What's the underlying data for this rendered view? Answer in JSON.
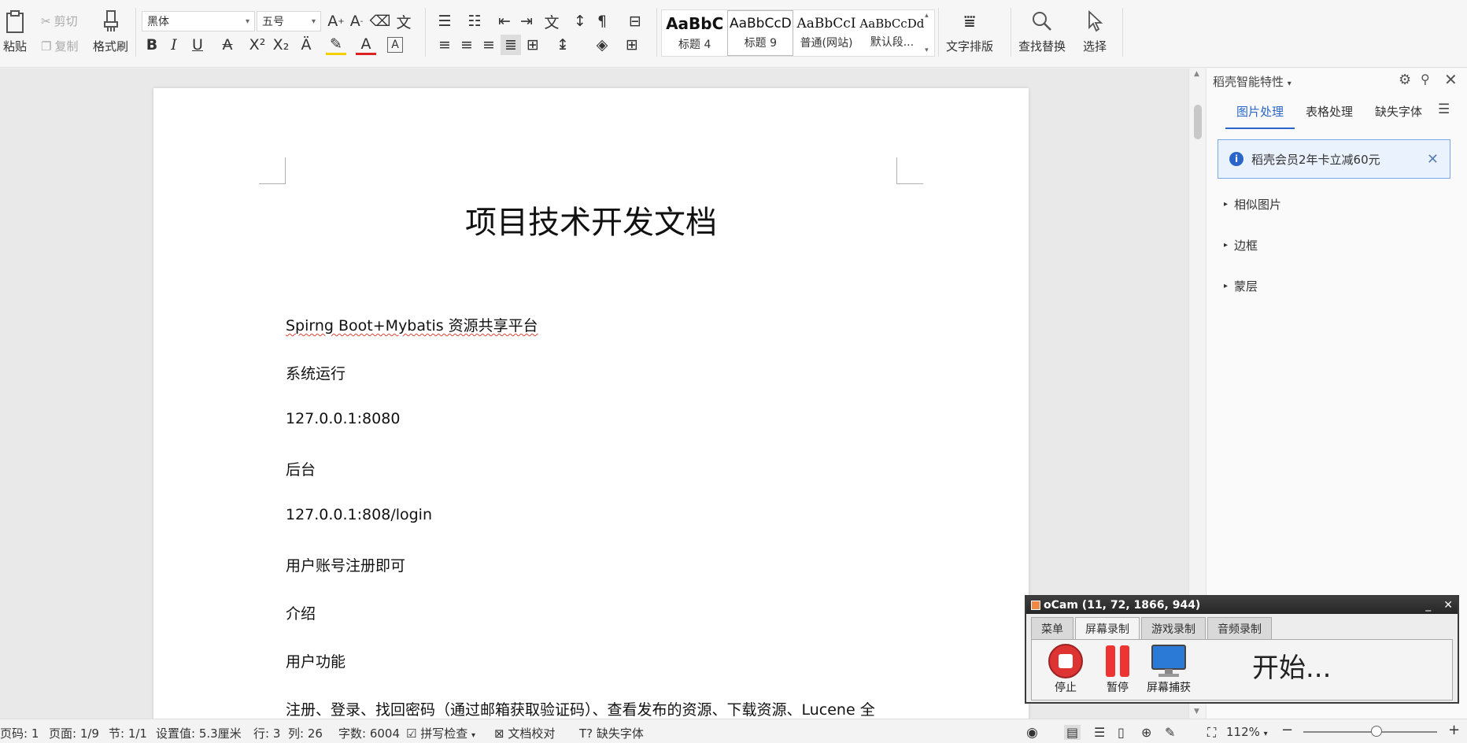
{
  "ribbon": {
    "paste": "粘贴",
    "cut": "剪切",
    "copy": "复制",
    "format_painter": "格式刷",
    "font_name": "黑体",
    "font_size": "五号",
    "styles": [
      {
        "preview": "AaBbC",
        "name": "标题 4"
      },
      {
        "preview": "AaBbCcD",
        "name": "标题 9"
      },
      {
        "preview": "AaBbCcI",
        "name": "普通(网站)"
      },
      {
        "preview": "AaBbCcDd",
        "name": "默认段..."
      }
    ],
    "text_layout": "文字排版",
    "find_replace": "查找替换",
    "select": "选择"
  },
  "document": {
    "title": "项目技术开发文档",
    "lines": [
      "Spirng Boot+Mybatis 资源共享平台",
      "系统运行",
      "127.0.0.1:8080",
      "后台",
      "127.0.0.1:808/login",
      "用户账号注册即可",
      "介绍",
      "用户功能",
      "注册、登录、找回密码（通过邮箱获取验证码）、查看发布的资源、下载资源、Lucene 全"
    ]
  },
  "side_panel": {
    "title": "稻壳智能特性",
    "tabs": [
      "图片处理",
      "表格处理",
      "缺失字体"
    ],
    "notice": "稻壳会员2年卡立减60元",
    "sections": [
      "相似图片",
      "边框",
      "蒙层"
    ]
  },
  "status_bar": {
    "page_code": "页码: 1",
    "page": "页面: 1/9",
    "section": "节: 1/1",
    "setting": "设置值: 5.3厘米",
    "row": "行: 3",
    "col": "列: 26",
    "word_count": "字数: 6004",
    "spell_check": "拼写检查",
    "proofread": "文档校对",
    "missing_font": "缺失字体",
    "zoom": "112%"
  },
  "ocam": {
    "title": "oCam (11, 72, 1866, 944)",
    "tabs": [
      "菜单",
      "屏幕录制",
      "游戏录制",
      "音频录制"
    ],
    "stop": "停止",
    "pause": "暂停",
    "capture": "屏幕捕获",
    "start": "开始..."
  }
}
